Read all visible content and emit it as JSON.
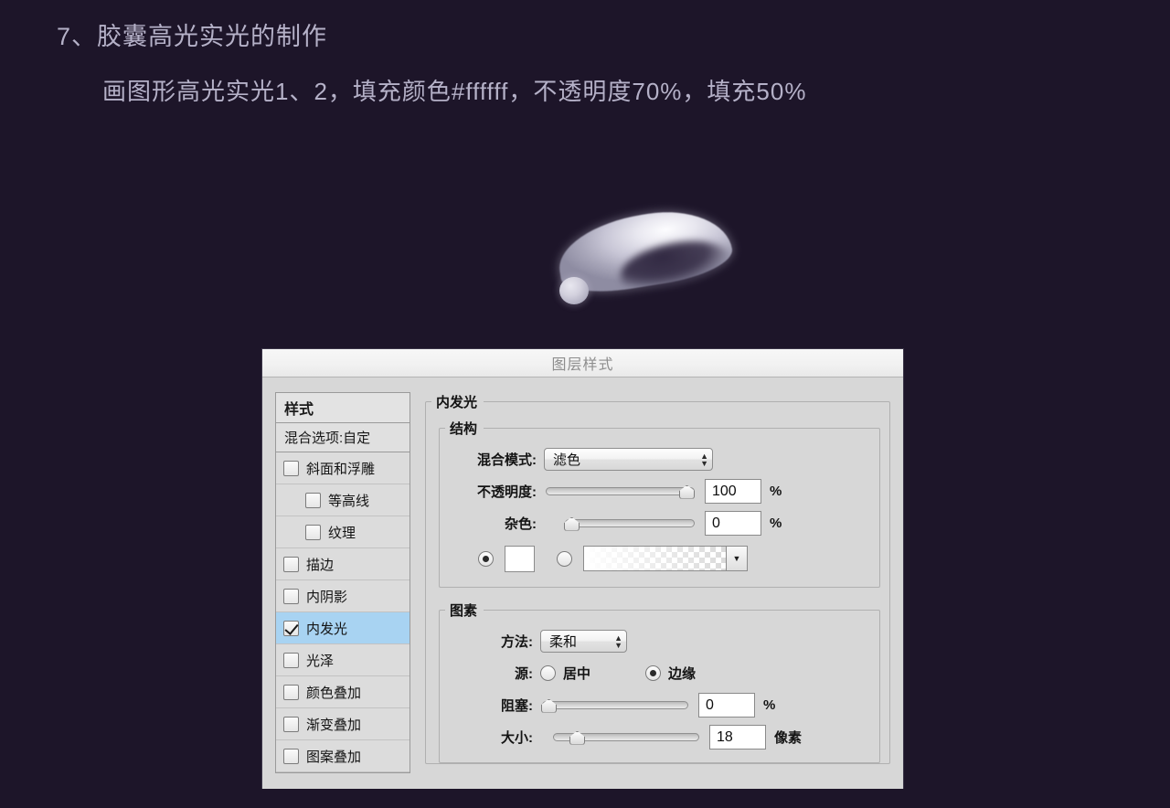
{
  "caption": {
    "line1": "7、胶囊高光实光的制作",
    "line2": "画图形高光实光1、2，填充颜色#ffffff，不透明度70%，填充50%"
  },
  "artwork": {
    "shape_big_name": "highlight-shape-1",
    "shape_small_name": "highlight-shape-2",
    "background_color": "#1d1529",
    "text_color": "#b5b1c8"
  },
  "dialog": {
    "title": "图层样式",
    "styles_panel": {
      "header": "样式",
      "blending_options": "混合选项:自定",
      "items": [
        {
          "label": "斜面和浮雕",
          "checked": false,
          "indent": false,
          "selected": false
        },
        {
          "label": "等高线",
          "checked": false,
          "indent": true,
          "selected": false
        },
        {
          "label": "纹理",
          "checked": false,
          "indent": true,
          "selected": false
        },
        {
          "label": "描边",
          "checked": false,
          "indent": false,
          "selected": false
        },
        {
          "label": "内阴影",
          "checked": false,
          "indent": false,
          "selected": false
        },
        {
          "label": "内发光",
          "checked": true,
          "indent": false,
          "selected": true
        },
        {
          "label": "光泽",
          "checked": false,
          "indent": false,
          "selected": false
        },
        {
          "label": "颜色叠加",
          "checked": false,
          "indent": false,
          "selected": false
        },
        {
          "label": "渐变叠加",
          "checked": false,
          "indent": false,
          "selected": false
        },
        {
          "label": "图案叠加",
          "checked": false,
          "indent": false,
          "selected": false
        }
      ]
    },
    "panel": {
      "group_title": "内发光",
      "structure": {
        "legend": "结构",
        "blend_mode_label": "混合模式:",
        "blend_mode_value": "滤色",
        "opacity_label": "不透明度:",
        "opacity_value": "100",
        "opacity_unit": "%",
        "opacity_percent": 100,
        "noise_label": "杂色:",
        "noise_value": "0",
        "noise_unit": "%",
        "noise_percent": 0,
        "color_radio_selected": true,
        "color_swatch_hex": "#ffffff",
        "gradient_radio_selected": false
      },
      "elements": {
        "legend": "图素",
        "method_label": "方法:",
        "method_value": "柔和",
        "source_label": "源:",
        "source_centre_label": "居中",
        "source_edge_label": "边缘",
        "source_selected": "边缘",
        "choke_label": "阻塞:",
        "choke_value": "0",
        "choke_unit": "%",
        "choke_percent": 0,
        "size_label": "大小:",
        "size_value": "18",
        "size_unit": "像素",
        "size_percent": 12
      }
    },
    "colors": {
      "titlebar": "#f1f1f1",
      "body": "#d7d7d7",
      "selection": "#a8d3f2"
    }
  }
}
